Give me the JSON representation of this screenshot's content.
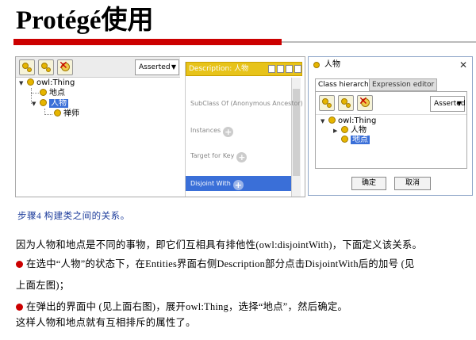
{
  "title": "Protégé使用",
  "left_panel": {
    "asserted_label": "Asserted",
    "tree": {
      "root": "owl:Thing",
      "children": [
        "地点",
        "人物"
      ],
      "grandchild": "禅师"
    },
    "description_header": "Description: 人物",
    "rows": [
      "SubClass Of (Anonymous Ancestor)",
      "Instances",
      "Target for Key",
      "Disjoint With"
    ]
  },
  "dialog": {
    "title": "人物",
    "close": "✕",
    "tabs": [
      "Class hierarchy",
      "Expression editor"
    ],
    "asserted_label": "Asserted",
    "tree": {
      "root": "owl:Thing",
      "children": [
        "人物",
        "地点"
      ]
    },
    "ok": "确定",
    "cancel": "取消"
  },
  "text": {
    "step": "步骤4 构建类之间的关系。",
    "line1": "因为人物和地点是不同的事物，即它们互相具有排他性(owl:disjointWith)，下面定义该关系。",
    "bullet1a": "在选中“人物”的状态下，在Entities界面右侧Description部分点击DisjointWith后的加号 (见",
    "bullet1b": "上面左图)；",
    "bullet2": "在弹出的界面中 (见上面右图)，展开owl:Thing，选择“地点”，然后确定。",
    "line_last": "这样人物和地点就有互相排斥的属性了。"
  },
  "colors": {
    "title_rule": "#cc0000",
    "step_text": "#1a3a9a",
    "selection": "#3a6fd8",
    "description_header": "#e7c31a",
    "bullet": "#cc0000"
  }
}
